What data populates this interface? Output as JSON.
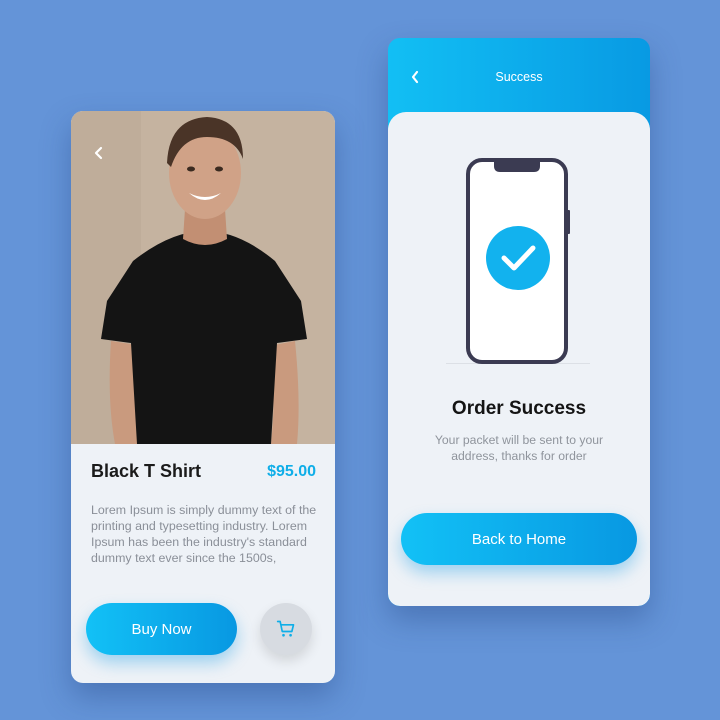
{
  "product": {
    "back_icon": "chevron-left-icon",
    "title": "Black T Shirt",
    "price": "$95.00",
    "description": "Lorem Ipsum is simply dummy text of the printing and typesetting industry. Lorem Ipsum has been the industry's standard dummy text ever since the 1500s,",
    "buy_label": "Buy Now",
    "cart_icon": "shopping-cart-icon"
  },
  "success": {
    "header_title": "Success",
    "back_icon": "chevron-left-icon",
    "illustration_icon": "phone-checkmark-icon",
    "title": "Order Success",
    "message": "Your packet will be sent to your address, thanks for order",
    "home_label": "Back to Home"
  },
  "colors": {
    "background": "#6494d8",
    "accent": "#0faee8",
    "card": "#eef2f7"
  }
}
